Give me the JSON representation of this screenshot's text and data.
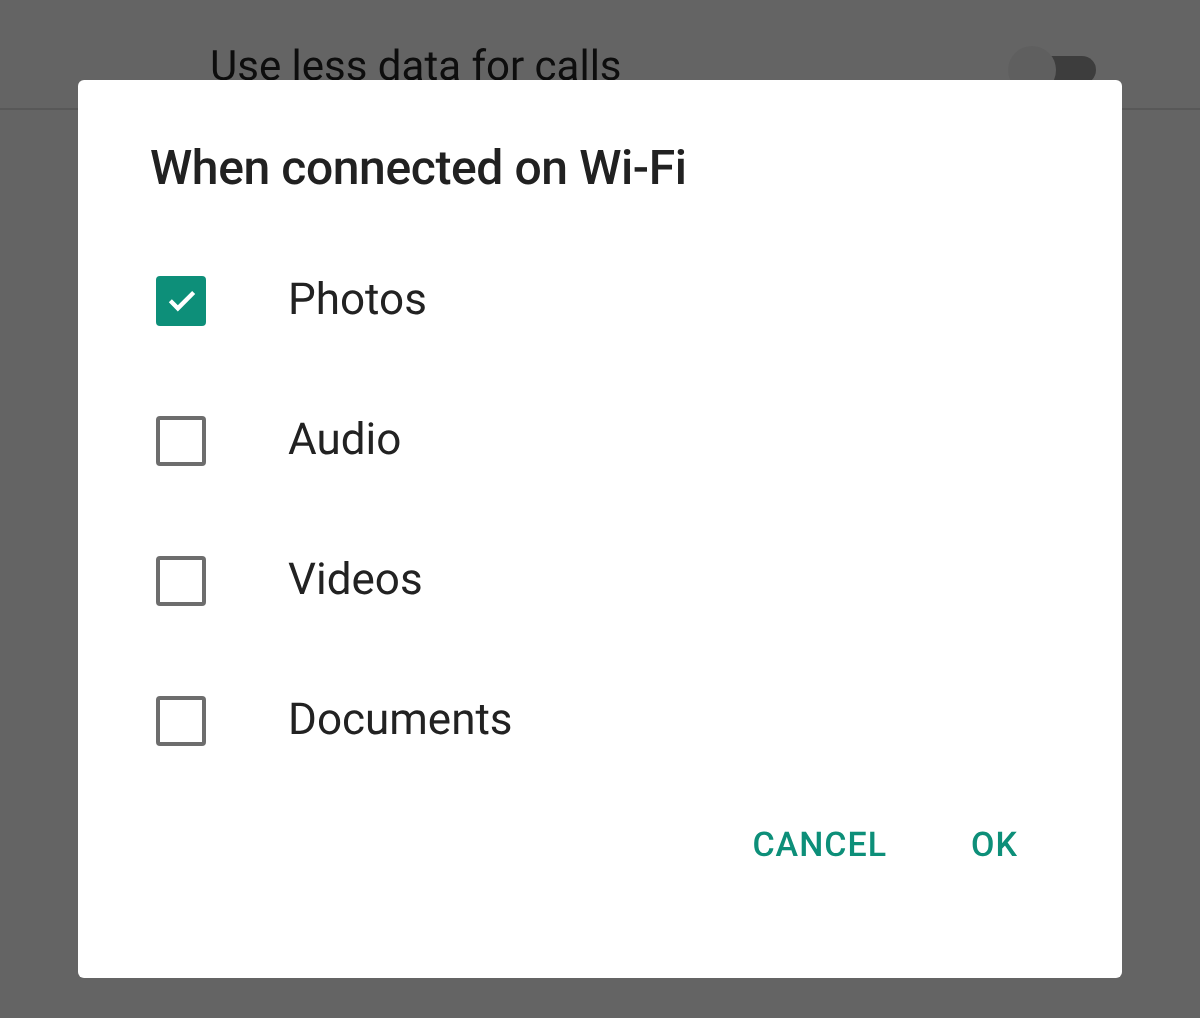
{
  "background_setting": {
    "label": "Use less data for calls",
    "on": false
  },
  "dialog": {
    "title": "When connected on Wi-Fi",
    "options": [
      {
        "label": "Photos",
        "checked": true
      },
      {
        "label": "Audio",
        "checked": false
      },
      {
        "label": "Videos",
        "checked": false
      },
      {
        "label": "Documents",
        "checked": false
      }
    ],
    "buttons": [
      "CANCEL",
      "OK"
    ]
  }
}
